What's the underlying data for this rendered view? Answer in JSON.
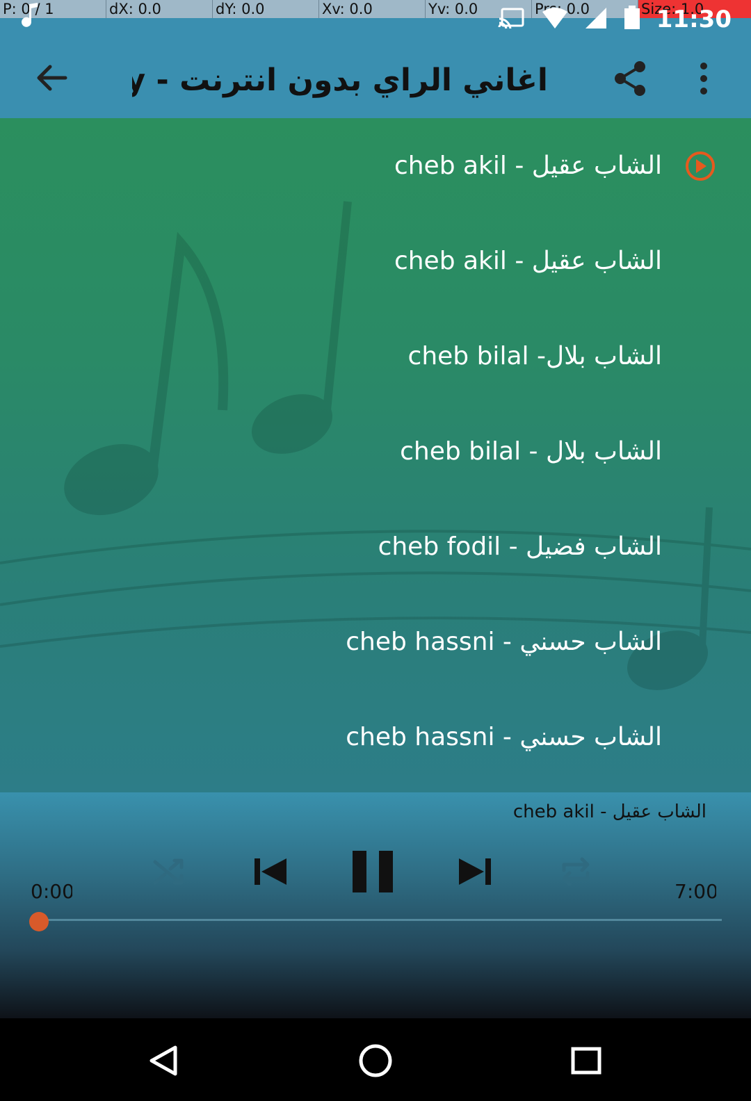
{
  "debug": {
    "pointer": "P: 0 / 1",
    "dx": "dX: 0.0",
    "dy": "dY: 0.0",
    "xv": "Xv: 0.0",
    "yv": "Yv: 0.0",
    "prs": "Prs: 0.0",
    "size": "Size: 1.0"
  },
  "status": {
    "time": "11:30",
    "icons": [
      "music-note-icon",
      "cast-icon",
      "wifi-icon",
      "signal-icon",
      "battery-icon"
    ]
  },
  "appbar": {
    "title": "اغاني الراي بدون انترنت - Play",
    "back_icon": "arrow-back-icon",
    "share_icon": "share-icon",
    "more_icon": "more-vert-icon"
  },
  "tracks": [
    {
      "label": "الشاب عقيل - cheb akil",
      "playing": true
    },
    {
      "label": "الشاب عقيل - cheb akil",
      "playing": false
    },
    {
      "label": "الشاب بلال- cheb bilal",
      "playing": false
    },
    {
      "label": "الشاب بلال - cheb bilal",
      "playing": false
    },
    {
      "label": "الشاب فضيل - cheb fodil",
      "playing": false
    },
    {
      "label": "الشاب حسني - cheb hassni",
      "playing": false
    },
    {
      "label": "الشاب حسني - cheb hassni",
      "playing": false
    }
  ],
  "player": {
    "now_playing": "الشاب عقيل - cheb akil",
    "current_time": "0:00",
    "duration": "7:00",
    "progress": 0,
    "controls": [
      "shuffle-icon",
      "skip-previous-icon",
      "pause-icon",
      "skip-next-icon",
      "repeat-icon"
    ]
  },
  "colors": {
    "appbar": "#3a8fb0",
    "list_top": "#2b8f5e",
    "list_bottom": "#2d7d88",
    "seek_thumb": "#d85a2a"
  }
}
